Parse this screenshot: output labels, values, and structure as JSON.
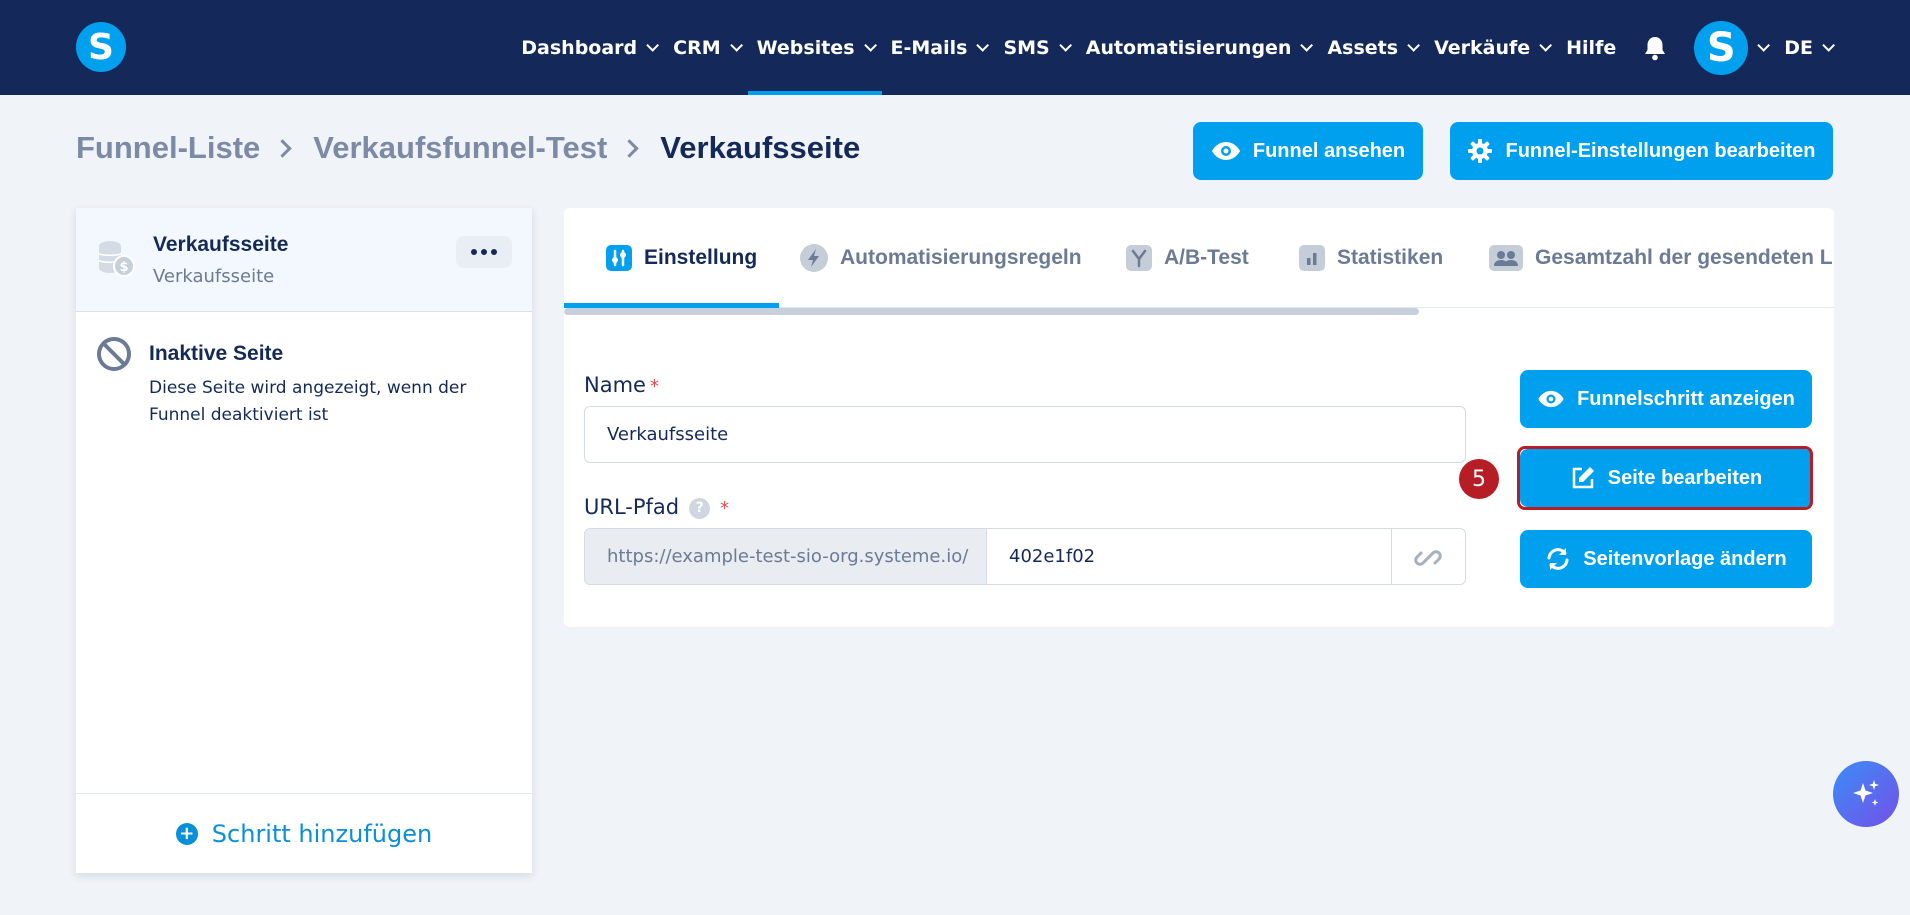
{
  "colors": {
    "nav_bg": "#14295a",
    "accent": "#00a0ee",
    "highlight": "#b61d24",
    "page_bg": "#f0f3f8"
  },
  "nav": {
    "logo_letter": "S",
    "items": [
      {
        "label": "Dashboard"
      },
      {
        "label": "CRM"
      },
      {
        "label": "Websites",
        "active": true
      },
      {
        "label": "E-Mails"
      },
      {
        "label": "SMS"
      },
      {
        "label": "Automatisierungen"
      },
      {
        "label": "Assets"
      },
      {
        "label": "Verkäufe"
      }
    ],
    "help_label": "Hilfe",
    "bell_icon": "bell-icon",
    "avatar_letter": "S",
    "language": "DE"
  },
  "breadcrumb": [
    "Funnel-Liste",
    "Verkaufsfunnel-Test",
    "Verkaufsseite"
  ],
  "header_buttons": {
    "view_funnel": "Funnel ansehen",
    "edit_settings": "Funnel-Einstellungen bearbeiten"
  },
  "sidebar": {
    "active_step": {
      "title": "Verkaufsseite",
      "subtitle": "Verkaufsseite"
    },
    "inactive_page": {
      "title": "Inaktive Seite",
      "description": "Diese Seite wird angezeigt, wenn der Funnel deaktiviert ist"
    },
    "add_step": "Schritt hinzufügen"
  },
  "tabs": [
    {
      "label": "Einstellung",
      "icon": "sliders-icon",
      "active": true
    },
    {
      "label": "Automatisierungsregeln",
      "icon": "bolt-icon"
    },
    {
      "label": "A/B-Test",
      "icon": "split-icon"
    },
    {
      "label": "Statistiken",
      "icon": "bar-chart-icon"
    },
    {
      "label": "Gesamtzahl der gesendeten L",
      "icon": "users-icon"
    }
  ],
  "form": {
    "name_label": "Name",
    "name_value": "Verkaufsseite",
    "url_label": "URL-Pfad",
    "url_prefix": "https://example-test-sio-org.systeme.io/",
    "url_value": "402e1f02",
    "required_mark": "*",
    "help_mark": "?"
  },
  "actions": {
    "show_step": "Funnelschritt anzeigen",
    "edit_page": "Seite bearbeiten",
    "change_template": "Seitenvorlage ändern"
  },
  "annotation": {
    "step_number": "5"
  }
}
